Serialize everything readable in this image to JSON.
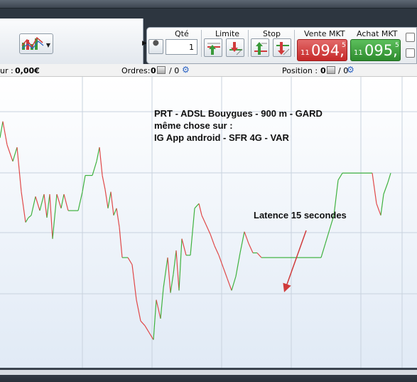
{
  "toolbar": {
    "qty_label": "Qté",
    "qty_value": "1",
    "limit_label": "Limite",
    "stop_label": "Stop",
    "sell_label": "Vente MKT",
    "buy_label": "Achat MKT",
    "sell_price": {
      "lead": "11",
      "main": "094,",
      "sup": "5"
    },
    "buy_price": {
      "lead": "11",
      "main": "095,",
      "sup": "5"
    },
    "sell_color": "#d03b3b",
    "buy_color": "#3a9a3a"
  },
  "infobar": {
    "pnl_label": "ur :",
    "pnl_value": "0,00€",
    "orders_label": "Ordres:",
    "orders_a": "0",
    "orders_sep": "/ 0",
    "position_label": "Position :",
    "position_a": "0",
    "position_sep": "/ 0"
  },
  "annotations": {
    "line1": "PRT - ADSL Bouygues - 900 m - GARD",
    "line2": "même chose sur :",
    "line3": "IG App android  - SFR 4G - VAR",
    "latency": "Latence 15 secondes"
  },
  "chart_data": {
    "type": "line",
    "title": "",
    "xlabel": "",
    "ylabel": "",
    "grid": true,
    "up_color": "#3fb23f",
    "down_color": "#e04848",
    "background_gradient": [
      "#ffffff",
      "#dfe9f5"
    ],
    "y_gridline_count": 4,
    "x_gridline_count": 6,
    "note": "",
    "series": [
      {
        "name": "",
        "x": [
          0,
          4,
          10,
          18,
          24,
          30,
          36,
          40,
          44,
          50,
          56,
          62,
          66,
          70,
          74,
          80,
          86,
          90,
          96,
          102,
          110,
          116,
          120,
          124,
          130,
          136,
          140,
          144,
          148,
          152,
          156,
          160,
          164,
          168,
          172,
          176,
          180,
          186,
          192,
          198,
          204,
          210,
          216,
          220,
          226,
          230,
          236,
          240,
          244,
          248,
          252,
          256,
          262,
          268,
          274,
          280,
          284,
          290,
          296,
          302,
          308,
          314,
          320,
          326,
          332,
          338,
          344,
          350,
          356,
          362,
          368,
          374,
          380,
          386,
          392,
          398,
          404,
          410,
          416,
          422,
          428,
          434,
          440,
          446,
          452,
          458,
          464,
          470,
          476,
          482,
          488,
          494,
          500,
          506,
          512,
          518,
          524,
          530,
          536,
          540,
          546,
          550
        ],
        "y": [
          55.4,
          56.1,
          55.1,
          54.4,
          55.0,
          53.1,
          51.8,
          52.0,
          52.1,
          52.9,
          52.3,
          53.0,
          52.0,
          53.0,
          51.1,
          53.0,
          52.4,
          53.0,
          52.3,
          52.3,
          52.3,
          53.1,
          53.8,
          53.8,
          53.8,
          54.4,
          55.0,
          53.8,
          53.2,
          52.4,
          53.1,
          52.1,
          52.4,
          51.6,
          50.3,
          50.3,
          50.3,
          50.0,
          48.5,
          47.6,
          47.4,
          47.1,
          46.8,
          48.5,
          47.7,
          49.0,
          50.3,
          48.8,
          49.6,
          50.6,
          48.9,
          51.1,
          50.4,
          50.4,
          52.4,
          52.6,
          52.1,
          51.7,
          51.3,
          50.8,
          50.4,
          49.9,
          49.4,
          48.9,
          49.5,
          50.5,
          51.4,
          50.9,
          50.5,
          50.5,
          50.3,
          50.3,
          50.3,
          50.3,
          50.3,
          50.3,
          50.3,
          50.3,
          50.3,
          50.3,
          50.3,
          50.3,
          50.3,
          50.3,
          50.3,
          50.9,
          51.5,
          52.1,
          53.6,
          53.9,
          53.9,
          53.9,
          53.9,
          53.9,
          53.9,
          53.9,
          53.9,
          52.6,
          52.1,
          53.0,
          53.5,
          53.9
        ]
      }
    ]
  }
}
